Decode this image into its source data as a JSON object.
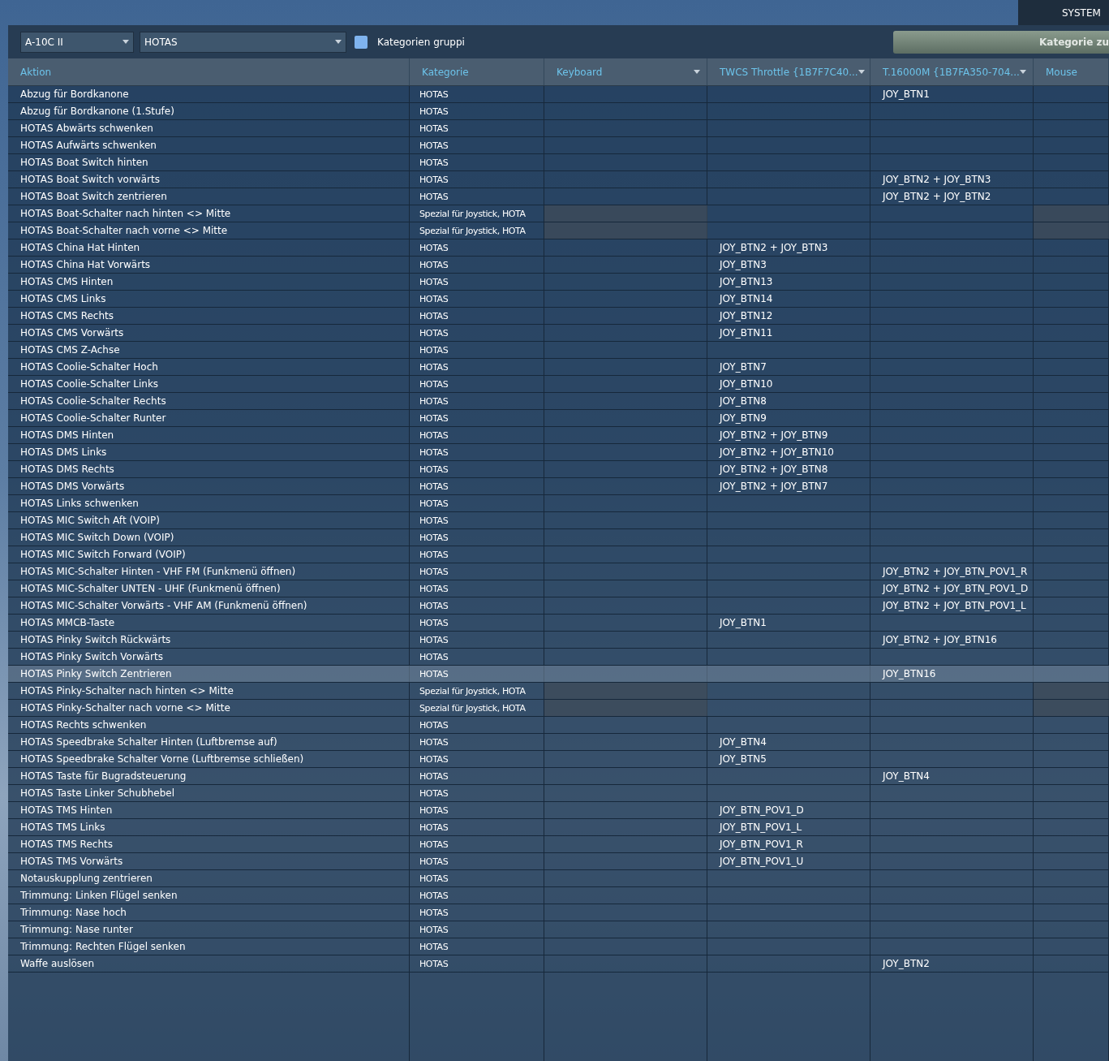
{
  "top_tab": {
    "label": "SYSTEM"
  },
  "toolbar": {
    "aircraft": "A-10C II",
    "category": "HOTAS",
    "group_checkbox": {
      "label": "Kategorien gruppi",
      "checked": false
    },
    "button": "Kategorie zu"
  },
  "table": {
    "columns": [
      {
        "label": "Aktion",
        "dropdown": false
      },
      {
        "label": "Kategorie",
        "dropdown": false
      },
      {
        "label": "Keyboard",
        "dropdown": true
      },
      {
        "label": "TWCS Throttle {1B7F7C40...",
        "dropdown": true
      },
      {
        "label": "T.16000M {1B7FA350-704...",
        "dropdown": true
      },
      {
        "label": "Mouse",
        "dropdown": false
      }
    ],
    "rows": [
      {
        "aktion": "Abzug für Bordkanone",
        "kategorie": "HOTAS",
        "twcs": "",
        "t16000": "JOY_BTN1",
        "special": false,
        "selected": false
      },
      {
        "aktion": "Abzug für Bordkanone (1.Stufe)",
        "kategorie": "HOTAS",
        "twcs": "",
        "t16000": "",
        "special": false,
        "selected": false
      },
      {
        "aktion": "HOTAS Abwärts schwenken",
        "kategorie": "HOTAS",
        "twcs": "",
        "t16000": "",
        "special": false,
        "selected": false
      },
      {
        "aktion": "HOTAS Aufwärts schwenken",
        "kategorie": "HOTAS",
        "twcs": "",
        "t16000": "",
        "special": false,
        "selected": false
      },
      {
        "aktion": "HOTAS Boat Switch hinten",
        "kategorie": "HOTAS",
        "twcs": "",
        "t16000": "",
        "special": false,
        "selected": false
      },
      {
        "aktion": "HOTAS Boat Switch vorwärts",
        "kategorie": "HOTAS",
        "twcs": "",
        "t16000": "JOY_BTN2 + JOY_BTN3",
        "special": false,
        "selected": false
      },
      {
        "aktion": "HOTAS Boat Switch zentrieren",
        "kategorie": "HOTAS",
        "twcs": "",
        "t16000": "JOY_BTN2 + JOY_BTN2",
        "special": false,
        "selected": false
      },
      {
        "aktion": "HOTAS Boat-Schalter nach hinten <> Mitte",
        "kategorie": "Spezial für Joystick, HOTA",
        "twcs": "",
        "t16000": "",
        "special": true,
        "selected": false
      },
      {
        "aktion": "HOTAS Boat-Schalter nach vorne <> Mitte",
        "kategorie": "Spezial für Joystick, HOTA",
        "twcs": "",
        "t16000": "",
        "special": true,
        "selected": false
      },
      {
        "aktion": "HOTAS China Hat Hinten",
        "kategorie": "HOTAS",
        "twcs": "JOY_BTN2 + JOY_BTN3",
        "t16000": "",
        "special": false,
        "selected": false
      },
      {
        "aktion": "HOTAS China Hat Vorwärts",
        "kategorie": "HOTAS",
        "twcs": "JOY_BTN3",
        "t16000": "",
        "special": false,
        "selected": false
      },
      {
        "aktion": "HOTAS CMS Hinten",
        "kategorie": "HOTAS",
        "twcs": "JOY_BTN13",
        "t16000": "",
        "special": false,
        "selected": false
      },
      {
        "aktion": "HOTAS CMS Links",
        "kategorie": "HOTAS",
        "twcs": "JOY_BTN14",
        "t16000": "",
        "special": false,
        "selected": false
      },
      {
        "aktion": "HOTAS CMS Rechts",
        "kategorie": "HOTAS",
        "twcs": "JOY_BTN12",
        "t16000": "",
        "special": false,
        "selected": false
      },
      {
        "aktion": "HOTAS CMS Vorwärts",
        "kategorie": "HOTAS",
        "twcs": "JOY_BTN11",
        "t16000": "",
        "special": false,
        "selected": false
      },
      {
        "aktion": "HOTAS CMS Z-Achse",
        "kategorie": "HOTAS",
        "twcs": "",
        "t16000": "",
        "special": false,
        "selected": false
      },
      {
        "aktion": "HOTAS Coolie-Schalter Hoch",
        "kategorie": "HOTAS",
        "twcs": "JOY_BTN7",
        "t16000": "",
        "special": false,
        "selected": false
      },
      {
        "aktion": "HOTAS Coolie-Schalter Links",
        "kategorie": "HOTAS",
        "twcs": "JOY_BTN10",
        "t16000": "",
        "special": false,
        "selected": false
      },
      {
        "aktion": "HOTAS Coolie-Schalter Rechts",
        "kategorie": "HOTAS",
        "twcs": "JOY_BTN8",
        "t16000": "",
        "special": false,
        "selected": false
      },
      {
        "aktion": "HOTAS Coolie-Schalter Runter",
        "kategorie": "HOTAS",
        "twcs": "JOY_BTN9",
        "t16000": "",
        "special": false,
        "selected": false
      },
      {
        "aktion": "HOTAS DMS Hinten",
        "kategorie": "HOTAS",
        "twcs": "JOY_BTN2 + JOY_BTN9",
        "t16000": "",
        "special": false,
        "selected": false
      },
      {
        "aktion": "HOTAS DMS Links",
        "kategorie": "HOTAS",
        "twcs": "JOY_BTN2 + JOY_BTN10",
        "t16000": "",
        "special": false,
        "selected": false
      },
      {
        "aktion": "HOTAS DMS Rechts",
        "kategorie": "HOTAS",
        "twcs": "JOY_BTN2 + JOY_BTN8",
        "t16000": "",
        "special": false,
        "selected": false
      },
      {
        "aktion": "HOTAS DMS Vorwärts",
        "kategorie": "HOTAS",
        "twcs": "JOY_BTN2 + JOY_BTN7",
        "t16000": "",
        "special": false,
        "selected": false
      },
      {
        "aktion": "HOTAS Links schwenken",
        "kategorie": "HOTAS",
        "twcs": "",
        "t16000": "",
        "special": false,
        "selected": false
      },
      {
        "aktion": "HOTAS MIC Switch Aft (VOIP)",
        "kategorie": "HOTAS",
        "twcs": "",
        "t16000": "",
        "special": false,
        "selected": false
      },
      {
        "aktion": "HOTAS MIC Switch Down (VOIP)",
        "kategorie": "HOTAS",
        "twcs": "",
        "t16000": "",
        "special": false,
        "selected": false
      },
      {
        "aktion": "HOTAS MIC Switch Forward (VOIP)",
        "kategorie": "HOTAS",
        "twcs": "",
        "t16000": "",
        "special": false,
        "selected": false
      },
      {
        "aktion": "HOTAS MIC-Schalter Hinten - VHF FM (Funkmenü öffnen)",
        "kategorie": "HOTAS",
        "twcs": "",
        "t16000": "JOY_BTN2 + JOY_BTN_POV1_R",
        "special": false,
        "selected": false
      },
      {
        "aktion": "HOTAS MIC-Schalter UNTEN - UHF (Funkmenü öffnen)",
        "kategorie": "HOTAS",
        "twcs": "",
        "t16000": "JOY_BTN2 + JOY_BTN_POV1_D",
        "special": false,
        "selected": false
      },
      {
        "aktion": "HOTAS MIC-Schalter Vorwärts - VHF AM (Funkmenü öffnen)",
        "kategorie": "HOTAS",
        "twcs": "",
        "t16000": "JOY_BTN2 + JOY_BTN_POV1_L",
        "special": false,
        "selected": false
      },
      {
        "aktion": "HOTAS MMCB-Taste",
        "kategorie": "HOTAS",
        "twcs": "JOY_BTN1",
        "t16000": "",
        "special": false,
        "selected": false
      },
      {
        "aktion": "HOTAS Pinky Switch Rückwärts",
        "kategorie": "HOTAS",
        "twcs": "",
        "t16000": "JOY_BTN2 + JOY_BTN16",
        "special": false,
        "selected": false
      },
      {
        "aktion": "HOTAS Pinky Switch Vorwärts",
        "kategorie": "HOTAS",
        "twcs": "",
        "t16000": "",
        "special": false,
        "selected": false
      },
      {
        "aktion": "HOTAS Pinky Switch Zentrieren",
        "kategorie": "HOTAS",
        "twcs": "",
        "t16000": "JOY_BTN16",
        "special": false,
        "selected": true
      },
      {
        "aktion": "HOTAS Pinky-Schalter nach hinten <> Mitte",
        "kategorie": "Spezial für Joystick, HOTA",
        "twcs": "",
        "t16000": "",
        "special": true,
        "selected": false
      },
      {
        "aktion": "HOTAS Pinky-Schalter nach vorne <> Mitte",
        "kategorie": "Spezial für Joystick, HOTA",
        "twcs": "",
        "t16000": "",
        "special": true,
        "selected": false
      },
      {
        "aktion": "HOTAS Rechts schwenken",
        "kategorie": "HOTAS",
        "twcs": "",
        "t16000": "",
        "special": false,
        "selected": false
      },
      {
        "aktion": "HOTAS Speedbrake Schalter Hinten (Luftbremse auf)",
        "kategorie": "HOTAS",
        "twcs": "JOY_BTN4",
        "t16000": "",
        "special": false,
        "selected": false
      },
      {
        "aktion": "HOTAS Speedbrake Schalter Vorne (Luftbremse schließen)",
        "kategorie": "HOTAS",
        "twcs": "JOY_BTN5",
        "t16000": "",
        "special": false,
        "selected": false
      },
      {
        "aktion": "HOTAS Taste für Bugradsteuerung",
        "kategorie": "HOTAS",
        "twcs": "",
        "t16000": "JOY_BTN4",
        "special": false,
        "selected": false
      },
      {
        "aktion": "HOTAS Taste Linker Schubhebel",
        "kategorie": "HOTAS",
        "twcs": "",
        "t16000": "",
        "special": false,
        "selected": false
      },
      {
        "aktion": "HOTAS TMS Hinten",
        "kategorie": "HOTAS",
        "twcs": "JOY_BTN_POV1_D",
        "t16000": "",
        "special": false,
        "selected": false
      },
      {
        "aktion": "HOTAS TMS Links",
        "kategorie": "HOTAS",
        "twcs": "JOY_BTN_POV1_L",
        "t16000": "",
        "special": false,
        "selected": false
      },
      {
        "aktion": "HOTAS TMS Rechts",
        "kategorie": "HOTAS",
        "twcs": "JOY_BTN_POV1_R",
        "t16000": "",
        "special": false,
        "selected": false
      },
      {
        "aktion": "HOTAS TMS Vorwärts",
        "kategorie": "HOTAS",
        "twcs": "JOY_BTN_POV1_U",
        "t16000": "",
        "special": false,
        "selected": false
      },
      {
        "aktion": "Notauskupplung zentrieren",
        "kategorie": "HOTAS",
        "twcs": "",
        "t16000": "",
        "special": false,
        "selected": false
      },
      {
        "aktion": "Trimmung: Linken Flügel senken",
        "kategorie": "HOTAS",
        "twcs": "",
        "t16000": "",
        "special": false,
        "selected": false
      },
      {
        "aktion": "Trimmung: Nase hoch",
        "kategorie": "HOTAS",
        "twcs": "",
        "t16000": "",
        "special": false,
        "selected": false
      },
      {
        "aktion": "Trimmung: Nase runter",
        "kategorie": "HOTAS",
        "twcs": "",
        "t16000": "",
        "special": false,
        "selected": false
      },
      {
        "aktion": "Trimmung: Rechten Flügel senken",
        "kategorie": "HOTAS",
        "twcs": "",
        "t16000": "",
        "special": false,
        "selected": false
      },
      {
        "aktion": "Waffe auslösen",
        "kategorie": "HOTAS",
        "twcs": "",
        "t16000": "JOY_BTN2",
        "special": false,
        "selected": false
      }
    ]
  }
}
